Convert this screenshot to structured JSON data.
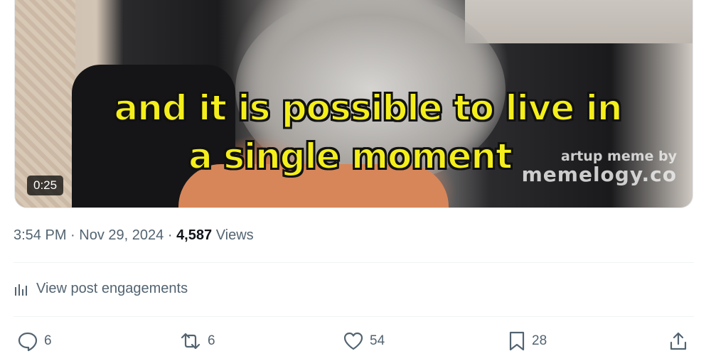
{
  "video": {
    "caption_line1": "and it is possible to live in",
    "caption_line2": "a single moment",
    "watermark_line1": "artup meme by",
    "watermark_line2": "memelogy.co",
    "duration": "0:25"
  },
  "meta": {
    "time": "3:54 PM",
    "date": "Nov 29, 2024",
    "separator": "·",
    "views_count": "4,587",
    "views_label": "Views"
  },
  "engagements_label": "View post engagements",
  "actions": {
    "replies": "6",
    "reposts": "6",
    "likes": "54",
    "bookmarks": "28"
  },
  "colors": {
    "text_secondary": "#536471",
    "text_primary": "#0f1419",
    "caption_yellow": "#f4ef1b",
    "divider": "#eff3f4"
  }
}
